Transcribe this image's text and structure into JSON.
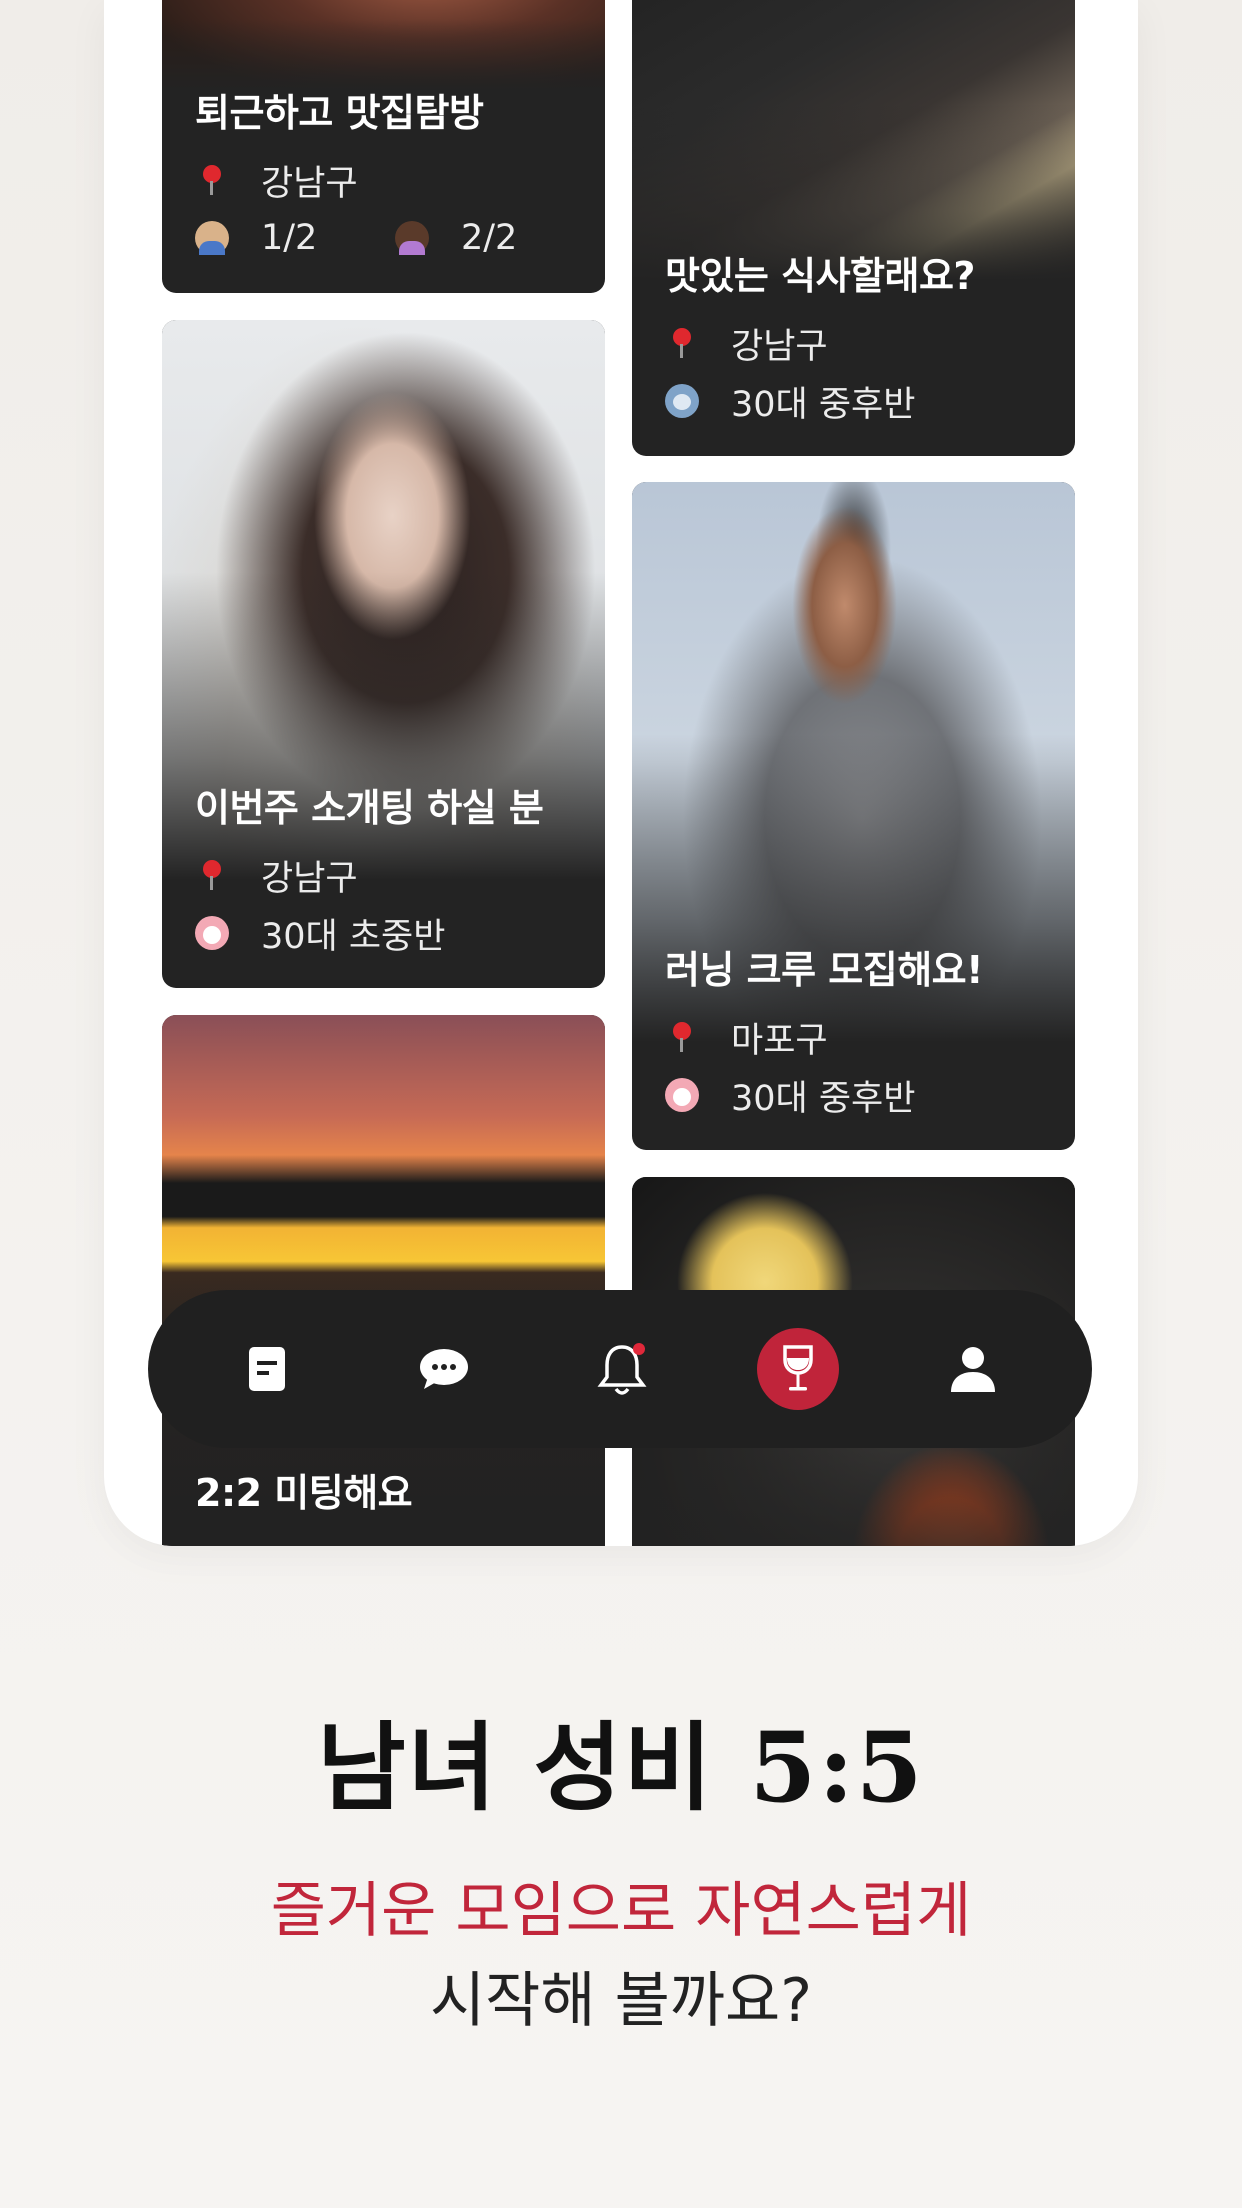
{
  "cards": [
    {
      "title": "퇴근하고 맛집탐방",
      "location": "강남구",
      "male_count": "1/2",
      "female_count": "2/2"
    },
    {
      "title": "맛있는 식사할래요?",
      "location": "강남구",
      "age": "30대 중후반"
    },
    {
      "title": "이번주 소개팅 하실 분",
      "location": "강남구",
      "age": "30대 초중반"
    },
    {
      "title": "러닝 크루 모집해요!",
      "location": "마포구",
      "age": "30대 중후반"
    },
    {
      "title": "2:2 미팅해요"
    }
  ],
  "nav": {
    "items": [
      "document-icon",
      "chat-icon",
      "bell-icon",
      "wine-glass-icon",
      "profile-icon"
    ],
    "active_index": 3
  },
  "headline": "남녀 성비 5:5",
  "subtitle_line1": "즐거운 모임으로 자연스럽게",
  "subtitle_line2": "시작해 볼까요?",
  "colors": {
    "accent": "#c1263b",
    "nav_bg": "#202020",
    "card_bg": "#232323"
  }
}
